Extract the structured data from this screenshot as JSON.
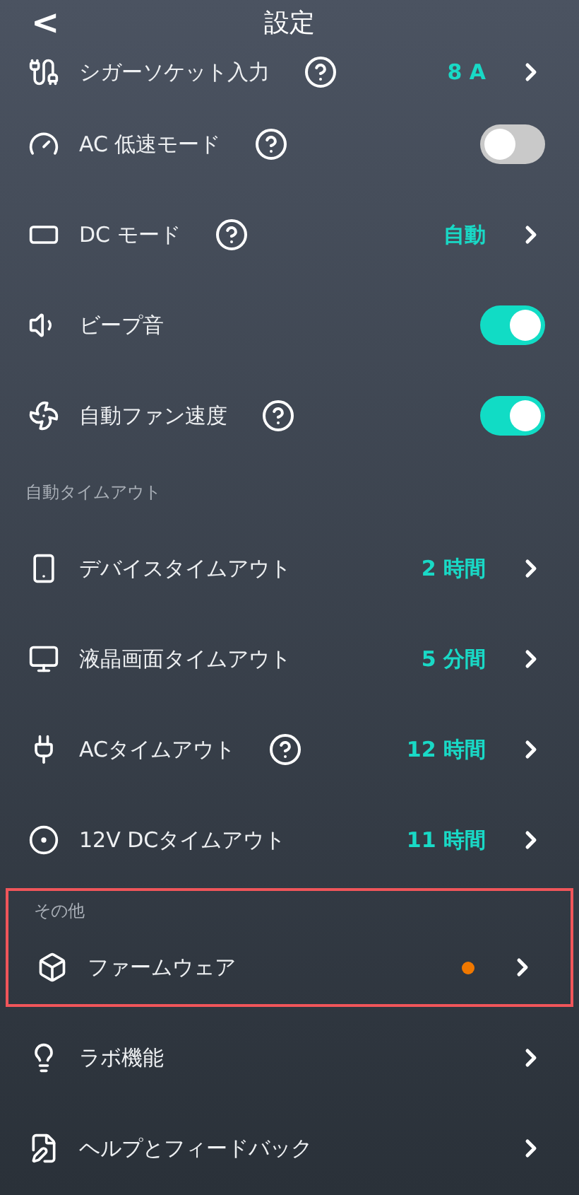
{
  "header": {
    "back": "<",
    "title": "設定"
  },
  "sections": [
    {
      "rows": [
        {
          "kind": "value",
          "label": "シガーソケット入力",
          "help": true,
          "value": "8 A",
          "clipped": true
        },
        {
          "kind": "toggle",
          "label": "AC 低速モード",
          "help": true,
          "on": false
        },
        {
          "kind": "value",
          "label": "DC モード",
          "help": true,
          "value": "自動"
        },
        {
          "kind": "toggle",
          "label": "ビープ音",
          "help": false,
          "on": true
        },
        {
          "kind": "toggle",
          "label": "自動ファン速度",
          "help": true,
          "on": true
        }
      ]
    },
    {
      "label": "自動タイムアウト",
      "rows": [
        {
          "kind": "value",
          "label": "デバイスタイムアウト",
          "help": false,
          "value": "2 時間"
        },
        {
          "kind": "value",
          "label": "液晶画面タイムアウト",
          "help": false,
          "value": "5 分間"
        },
        {
          "kind": "value",
          "label": "ACタイムアウト",
          "help": true,
          "value": "12 時間"
        },
        {
          "kind": "value",
          "label": "12V DCタイムアウト",
          "help": false,
          "value": "11 時間"
        }
      ]
    },
    {
      "label": "その他",
      "highlighted": true,
      "rows": [
        {
          "kind": "link",
          "label": "ファームウェア",
          "update_dot": true
        }
      ]
    },
    {
      "rows": [
        {
          "kind": "link",
          "label": "ラボ機能"
        },
        {
          "kind": "link",
          "label": "ヘルプとフィードバック"
        }
      ]
    }
  ]
}
